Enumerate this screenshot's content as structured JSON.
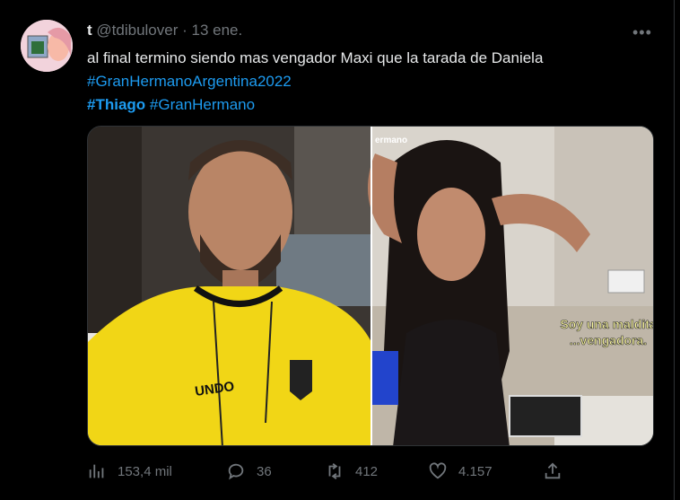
{
  "tweet": {
    "display_name": "t",
    "handle": "@tdibulover",
    "separator": "·",
    "date": "13 ene.",
    "more_icon": "more-icon",
    "text": "al final termino siendo mas vengador Maxi que la tarada de Daniela",
    "hashtags_line1": [
      "#GranHermanoArgentina2022"
    ],
    "hashtags_line2": [
      "#Thiago",
      "#GranHermano"
    ]
  },
  "media": {
    "left_watermark": "",
    "right_watermark": "ermano",
    "caption_line1": "Soy una maldita",
    "caption_line2": "...vengadora.",
    "shirt_text": "UNDO"
  },
  "actions": {
    "views": "153,4 mil",
    "replies": "36",
    "retweets": "412",
    "likes": "4.157"
  },
  "colors": {
    "background": "#000000",
    "text": "#e7e9ea",
    "muted": "#71767b",
    "link": "#1d9bf0"
  }
}
